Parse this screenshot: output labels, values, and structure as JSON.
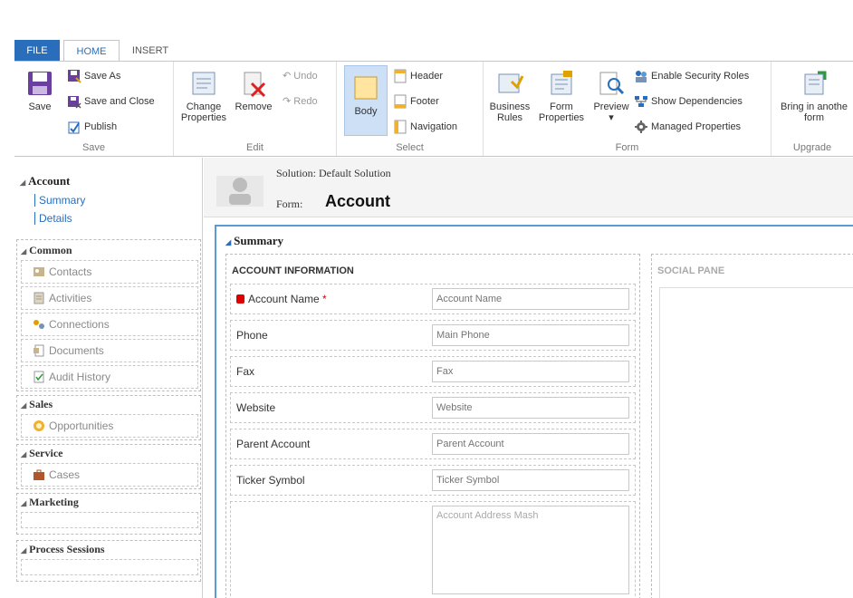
{
  "tabs": {
    "file": "FILE",
    "home": "HOME",
    "insert": "INSERT"
  },
  "ribbon": {
    "save_group": {
      "label": "Save",
      "save": "Save",
      "save_as": "Save As",
      "save_and_close": "Save and Close",
      "publish": "Publish"
    },
    "edit_group": {
      "label": "Edit",
      "change_properties_1": "Change",
      "change_properties_2": "Properties",
      "remove": "Remove",
      "undo": "Undo",
      "redo": "Redo"
    },
    "select_group": {
      "label": "Select",
      "body": "Body",
      "header": "Header",
      "footer": "Footer",
      "navigation": "Navigation"
    },
    "form_group": {
      "label": "Form",
      "business_rules_1": "Business",
      "business_rules_2": "Rules",
      "form_properties_1": "Form",
      "form_properties_2": "Properties",
      "preview": "Preview",
      "enable_security_roles": "Enable Security Roles",
      "show_dependencies": "Show Dependencies",
      "managed_properties": "Managed Properties"
    },
    "upgrade_group": {
      "label": "Upgrade",
      "bring_1": "Bring in anothe",
      "bring_2": "form"
    }
  },
  "nav": {
    "account_header": "Account",
    "summary": "Summary",
    "details": "Details",
    "sections": [
      {
        "title": "Common",
        "items": [
          "Contacts",
          "Activities",
          "Connections",
          "Documents",
          "Audit History"
        ]
      },
      {
        "title": "Sales",
        "items": [
          "Opportunities"
        ]
      },
      {
        "title": "Service",
        "items": [
          "Cases"
        ]
      },
      {
        "title": "Marketing",
        "items": []
      },
      {
        "title": "Process Sessions",
        "items": []
      }
    ]
  },
  "form": {
    "solution_label": "Solution: Default Solution",
    "form_label": "Form:",
    "form_name": "Account",
    "tab_title": "Summary",
    "section_title": "ACCOUNT INFORMATION",
    "social_title": "SOCIAL PANE",
    "fields": [
      {
        "label": "Account Name",
        "placeholder": "Account Name"
      },
      {
        "label": "Phone",
        "placeholder": "Main Phone"
      },
      {
        "label": "Fax",
        "placeholder": "Fax"
      },
      {
        "label": "Website",
        "placeholder": "Website"
      },
      {
        "label": "Parent Account",
        "placeholder": "Parent Account"
      },
      {
        "label": "Ticker Symbol",
        "placeholder": "Ticker Symbol"
      }
    ],
    "address_placeholder": "Account Address Mash",
    "required_mark": "*"
  }
}
